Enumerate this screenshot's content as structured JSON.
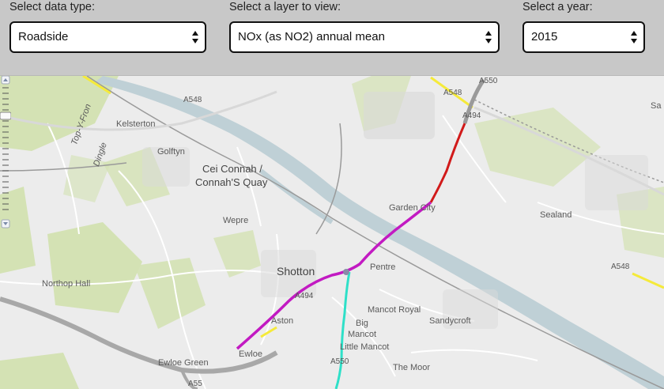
{
  "controls": {
    "data_type": {
      "label": "Select data type:",
      "value": "Roadside"
    },
    "layer": {
      "label": "Select a layer to view:",
      "value": "NOx (as NO2) annual mean"
    },
    "year": {
      "label": "Select a year:",
      "value": "2015"
    }
  },
  "map": {
    "places": {
      "kelsterton": "Kelsterton",
      "golftyn": "Golftyn",
      "connahs_quay_welsh": "Cei Connah /",
      "connahs_quay": "Connah'S Quay",
      "wepre": "Wepre",
      "shotton": "Shotton",
      "garden_city": "Garden City",
      "sealand": "Sealand",
      "pentre": "Pentre",
      "northop_hall": "Northop Hall",
      "aston": "Aston",
      "mancot_royal": "Mancot Royal",
      "sandycroft": "Sandycroft",
      "big_mancot_1": "Big",
      "big_mancot_2": "Mancot",
      "little_mancot": "Little Mancot",
      "ewloe_green": "Ewloe Green",
      "ewloe": "Ewloe",
      "the_moor": "The Moor",
      "top_y_fron": "Top-Y-Fron",
      "dingle": "Dingle",
      "edge_sa": "Sa"
    },
    "roads": {
      "a548_west": "A548",
      "a548_north": "A548",
      "a548_east": "A548",
      "a550_north": "A550",
      "a550_south": "A550",
      "a494_north": "A494",
      "a494_mid": "A494",
      "a55": "A55"
    },
    "colors": {
      "land": "#ececec",
      "water": "#bfd0d6",
      "green": "#d4e2b4",
      "pollution_low": "#2ee0c8",
      "pollution_high": "#c21ac2",
      "pollution_very_high": "#d11a1a",
      "highlighted_road": "#f5ea3a"
    }
  }
}
